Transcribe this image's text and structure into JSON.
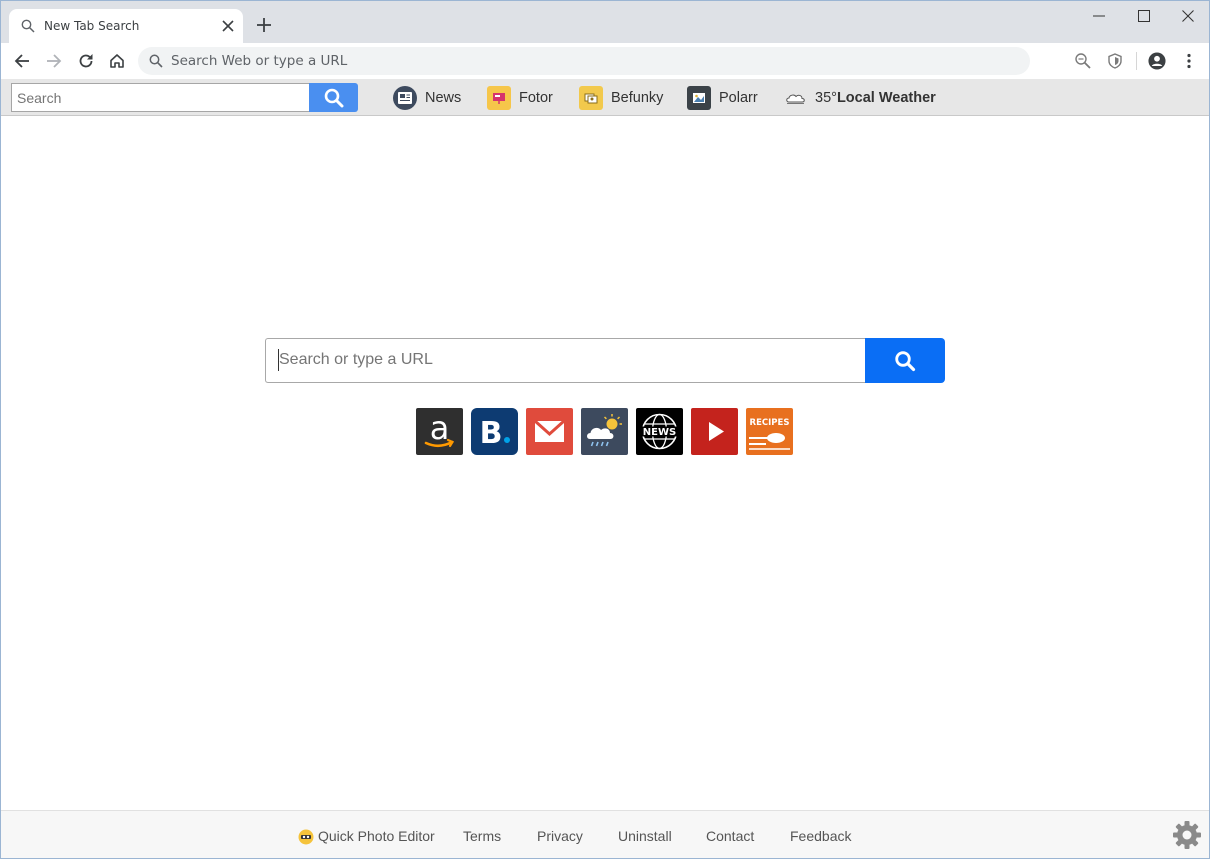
{
  "browser": {
    "tab_title": "New Tab Search",
    "omnibox_placeholder": "Search Web or type a URL"
  },
  "extension_bar": {
    "search_placeholder": "Search",
    "links": [
      {
        "label": "News",
        "icon": "news-icon"
      },
      {
        "label": "Fotor",
        "icon": "fotor-icon"
      },
      {
        "label": "Befunky",
        "icon": "befunky-icon"
      },
      {
        "label": "Polarr",
        "icon": "polarr-icon"
      }
    ],
    "weather": {
      "temp": "35°",
      "label": "Local Weather",
      "icon": "cloud-icon"
    }
  },
  "main": {
    "search_placeholder": "Search or type a URL",
    "accent_color": "#0a6ef5",
    "tiles": [
      {
        "name": "amazon",
        "color": "#2f2f2f"
      },
      {
        "name": "booking",
        "color": "#0d3b72"
      },
      {
        "name": "gmail",
        "color": "#e04b3c"
      },
      {
        "name": "weather",
        "color": "#3d4a5e"
      },
      {
        "name": "news",
        "label": "NEWS",
        "color": "#000000"
      },
      {
        "name": "youtube",
        "color": "#c4231d"
      },
      {
        "name": "recipes",
        "label": "RECIPES",
        "color": "#e8701f"
      }
    ]
  },
  "footer": {
    "links": [
      "Quick Photo Editor",
      "Terms",
      "Privacy",
      "Uninstall",
      "Contact",
      "Feedback"
    ]
  }
}
